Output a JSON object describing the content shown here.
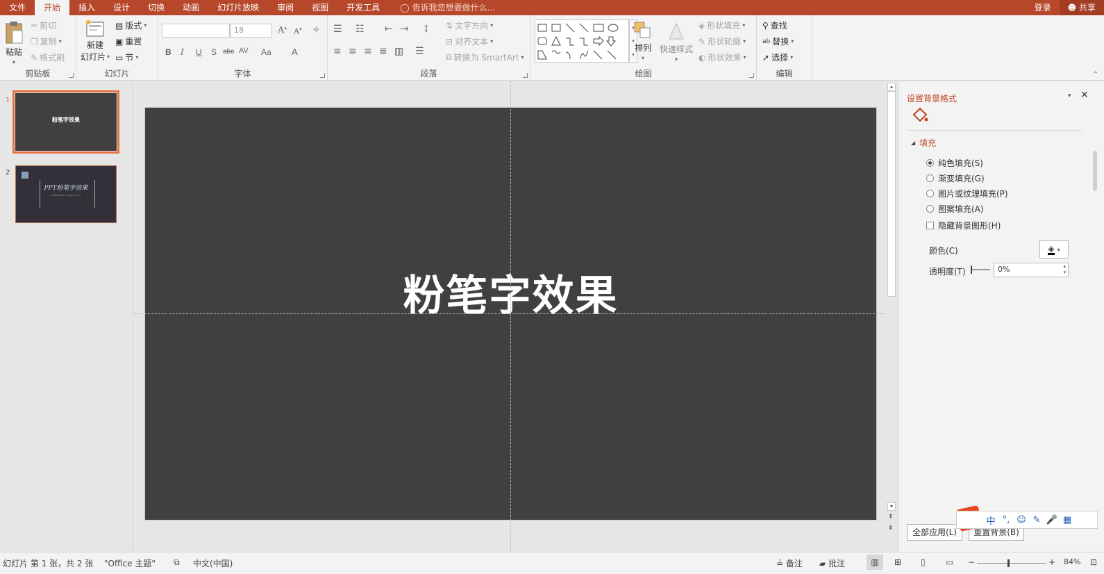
{
  "tabs": [
    "文件",
    "开始",
    "插入",
    "设计",
    "切换",
    "动画",
    "幻灯片放映",
    "审阅",
    "视图",
    "开发工具"
  ],
  "active_tab": "开始",
  "tell_me": "告诉我您想要做什么...",
  "signin": "登录",
  "share": "共享",
  "ribbon": {
    "clipboard": {
      "label": "剪贴板",
      "paste": "粘贴",
      "cut": "剪切",
      "copy": "复制",
      "format_painter": "格式刷"
    },
    "slides": {
      "label": "幻灯片",
      "new_slide_1": "新建",
      "new_slide_2": "幻灯片",
      "layout": "版式",
      "reset": "重置",
      "section": "节"
    },
    "font": {
      "label": "字体",
      "font_name": "",
      "font_size": "18",
      "bold": "B",
      "italic": "I",
      "underline": "U",
      "shadow": "S",
      "strike": "abc",
      "spacing": "AV",
      "case": "Aa",
      "color": "A"
    },
    "paragraph": {
      "label": "段落",
      "text_direction": "文字方向",
      "align_text": "对齐文本",
      "smartart": "转换为 SmartArt"
    },
    "drawing": {
      "label": "绘图",
      "arrange": "排列",
      "quick_styles": "快速样式",
      "shape_fill": "形状填充",
      "shape_outline": "形状轮廓",
      "shape_effects": "形状效果"
    },
    "editing": {
      "label": "编辑",
      "find": "查找",
      "replace": "替换",
      "select": "选择"
    }
  },
  "slides": [
    {
      "num": "1",
      "title": "粉笔字效果"
    },
    {
      "num": "2",
      "title": "PPT粉笔字效果",
      "subtitle": "POWERPOINT CHALK EFFECT"
    }
  ],
  "current_slide": {
    "title": "粉笔字效果"
  },
  "format_pane": {
    "title": "设置背景格式",
    "section": "填充",
    "options": [
      "纯色填充(S)",
      "渐变填充(G)",
      "图片或纹理填充(P)",
      "图案填充(A)"
    ],
    "selected_option": "纯色填充(S)",
    "hide_bg": "隐藏背景图形(H)",
    "color_label": "颜色(C)",
    "transparency_label": "透明度(T)",
    "transparency_value": "0%",
    "apply_all": "全部应用(L)",
    "reset_bg": "重置背景(B)"
  },
  "statusbar": {
    "slide_info": "幻灯片 第 1 张，共 2 张",
    "theme": "\"Office 主题\"",
    "language": "中文(中国)",
    "notes": "备注",
    "comments": "批注",
    "zoom": "84%"
  },
  "ime": {
    "lang": "中"
  }
}
